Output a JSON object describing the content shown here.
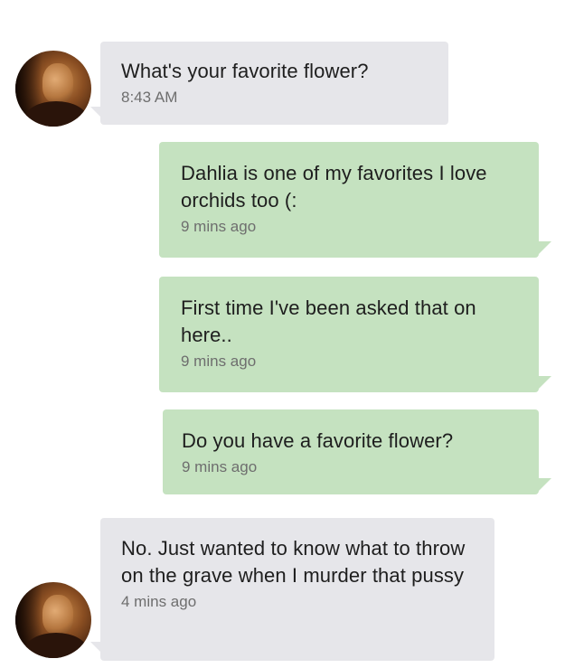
{
  "conversation": {
    "messages": [
      {
        "direction": "received",
        "text": "What's your favorite flower?",
        "time": "8:43 AM"
      },
      {
        "direction": "sent",
        "text": "Dahlia is one of my favorites I love orchids too (:",
        "time": "9 mins ago"
      },
      {
        "direction": "sent",
        "text": "First time I've been asked that on here..",
        "time": "9 mins ago"
      },
      {
        "direction": "sent",
        "text": "Do you have a favorite flower?",
        "time": "9 mins ago"
      },
      {
        "direction": "received",
        "text": "No. Just wanted to know what to throw on the grave when I murder that pussy",
        "time": "4 mins ago"
      }
    ]
  },
  "colors": {
    "received_bubble": "#e6e6ea",
    "sent_bubble": "#c5e2c0",
    "timestamp": "#6e6e6e",
    "text": "#1e1e1e"
  }
}
